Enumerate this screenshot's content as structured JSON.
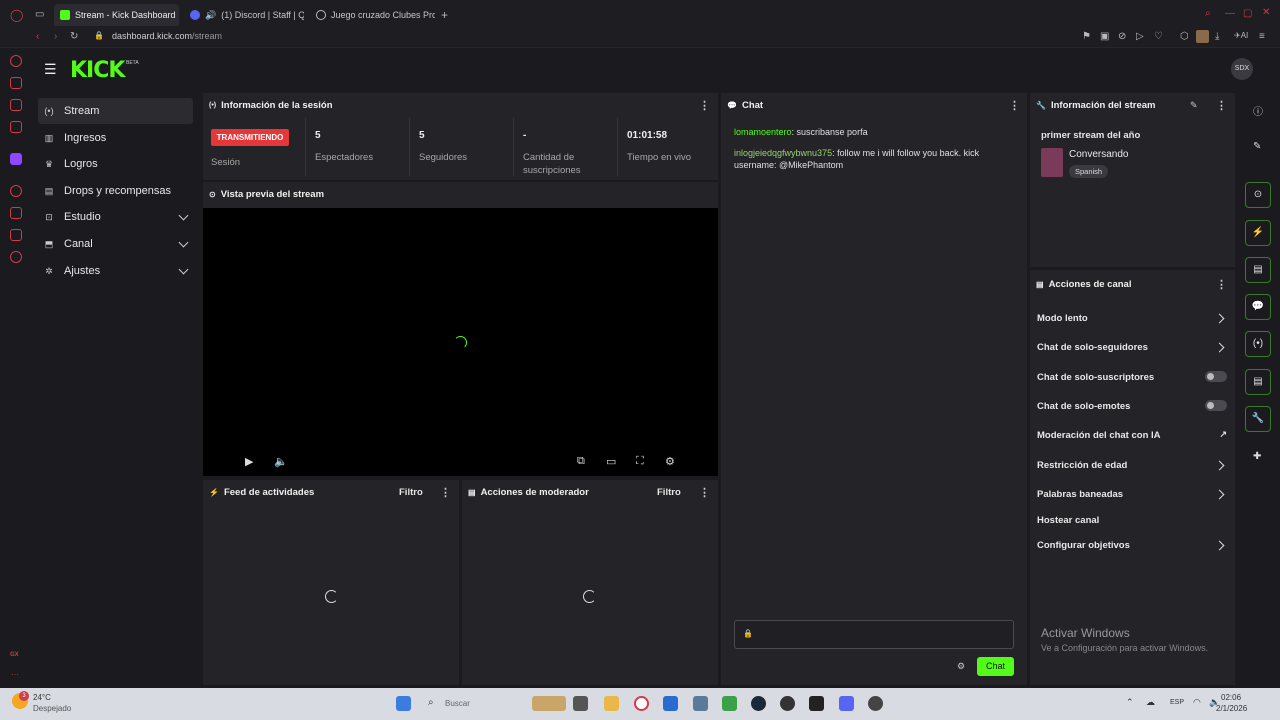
{
  "browser": {
    "tabs": [
      {
        "label": "Stream - Kick Dashboard",
        "active": true
      },
      {
        "label": "(1) Discord | Staff | Qu"
      },
      {
        "label": "Juego cruzado Clubes Pro"
      }
    ],
    "url_host": "dashboard.kick.com",
    "url_path": "/stream",
    "ai_label": "AI"
  },
  "header": {
    "logo": "KICK",
    "beta": "BETA",
    "avatar": "SDX"
  },
  "sidebar": {
    "items": [
      {
        "label": "Stream",
        "icon": "broadcast-icon"
      },
      {
        "label": "Ingresos",
        "icon": "revenue-icon"
      },
      {
        "label": "Logros",
        "icon": "trophy-icon"
      },
      {
        "label": "Drops y recompensas",
        "icon": "gift-icon"
      },
      {
        "label": "Estudio",
        "icon": "studio-icon"
      },
      {
        "label": "Canal",
        "icon": "channel-icon"
      },
      {
        "label": "Ajustes",
        "icon": "gear-icon"
      }
    ]
  },
  "session": {
    "title": "Información de la sesión",
    "status": "TRANSMITIENDO",
    "status_label": "Sesión",
    "stats": [
      {
        "value": "5",
        "label": "Espectadores"
      },
      {
        "value": "5",
        "label": "Seguidores"
      },
      {
        "value": "-",
        "label": "Cantidad de suscripciones"
      },
      {
        "value": "01:01:58",
        "label": "Tiempo en vivo"
      }
    ]
  },
  "preview": {
    "title": "Vista previa del stream"
  },
  "activity": {
    "title": "Feed de actividades",
    "filter": "Filtro"
  },
  "moderator": {
    "title": "Acciones de moderador",
    "filter": "Filtro"
  },
  "chat": {
    "title": "Chat",
    "messages": [
      {
        "user": "lomamoentero",
        "text": ": suscribanse porfa"
      },
      {
        "user": "inlogjeiedqgfwybwnu375",
        "text": ": follow me i will follow you back. kick username: @MikePhantom"
      }
    ],
    "send_label": "Chat"
  },
  "stream_info": {
    "title": "Información del stream",
    "stream_title": "primer stream del año",
    "category": "Conversando",
    "language": "Spanish"
  },
  "channel_actions": {
    "title": "Acciones de canal",
    "items": [
      {
        "label": "Modo lento",
        "kind": "chevron"
      },
      {
        "label": "Chat de solo-seguidores",
        "kind": "chevron"
      },
      {
        "label": "Chat de solo-suscriptores",
        "kind": "toggle"
      },
      {
        "label": "Chat de solo-emotes",
        "kind": "toggle"
      },
      {
        "label": "Moderación del chat con IA",
        "kind": "external"
      },
      {
        "label": "Restricción de edad",
        "kind": "chevron"
      },
      {
        "label": "Palabras baneadas",
        "kind": "chevron"
      },
      {
        "label": "Hostear canal",
        "kind": "none"
      },
      {
        "label": "Configurar objetivos",
        "kind": "chevron"
      }
    ]
  },
  "watermark": {
    "line1": "Activar Windows",
    "line2": "Ve a Configuración para activar Windows."
  },
  "taskbar": {
    "weather_temp": "24°C",
    "weather_desc": "Despejado",
    "weather_badge": "3",
    "search_placeholder": "Buscar",
    "lang": "ESP",
    "time": "02:06",
    "date": "2/1/2026"
  },
  "opera": {
    "gx_label": "GX"
  }
}
